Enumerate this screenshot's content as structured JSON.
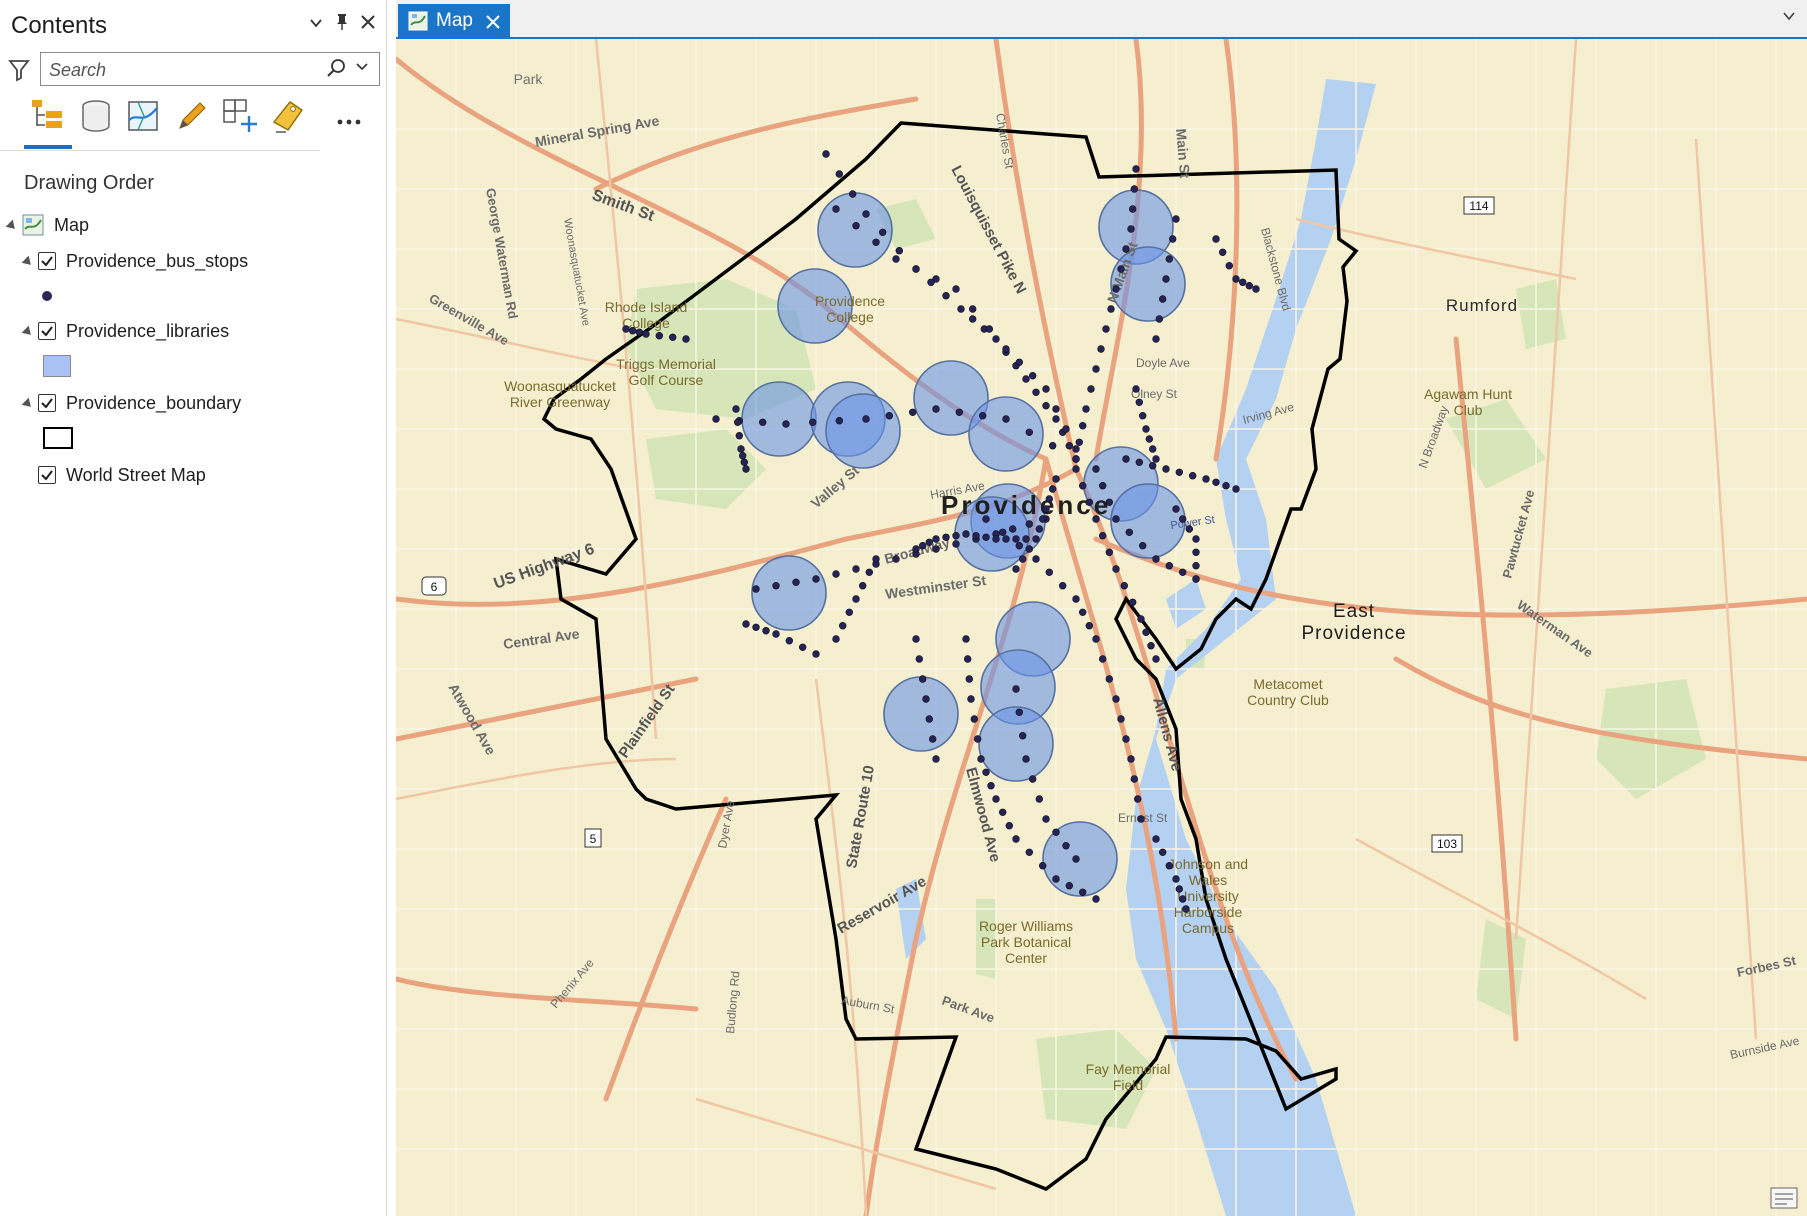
{
  "contents_pane": {
    "title": "Contents",
    "search_placeholder": "Search",
    "section_title": "Drawing Order",
    "toolbar_icons": [
      "list-by-drawing-order-icon",
      "list-by-source-icon",
      "list-by-selection-icon",
      "list-by-editing-icon",
      "list-by-snapping-icon",
      "list-by-labeling-icon",
      "more-options-icon"
    ],
    "layers": {
      "map": {
        "label": "Map"
      },
      "bus_stops": {
        "label": "Providence_bus_stops",
        "checked": true
      },
      "libraries": {
        "label": "Providence_libraries",
        "checked": true,
        "symbol_color": "#a8c2f5"
      },
      "boundary": {
        "label": "Providence_boundary",
        "checked": true
      },
      "basemap": {
        "label": "World Street Map",
        "checked": true
      }
    }
  },
  "map_view": {
    "tab_label": "Map",
    "accent_color": "#1a74c8",
    "place_labels": {
      "providence": "Providence",
      "east_providence_1": "East",
      "east_providence_2": "Providence",
      "rumford": "Rumford",
      "park": "Park",
      "ri_college_1": "Rhode Island",
      "ri_college_2": "College",
      "prov_college_1": "Providence",
      "prov_college_2": "College",
      "triggs_1": "Triggs Memorial",
      "triggs_2": "Golf Course",
      "woonasquatucket_1": "Woonasquatucket",
      "woonasquatucket_2": "River Greenway",
      "agawam_1": "Agawam Hunt",
      "agawam_2": "Club",
      "metacomet_1": "Metacomet",
      "metacomet_2": "Country Club",
      "jwu_1": "Johnson and",
      "jwu_2": "Wales",
      "jwu_3": "University",
      "jwu_4": "Harborside",
      "jwu_5": "Campus",
      "rw_park_1": "Roger Williams",
      "rw_park_2": "Park Botanical",
      "rw_park_3": "Center",
      "fay_1": "Fay Memorial",
      "fay_2": "Field"
    },
    "road_labels": {
      "mineral_spring": "Mineral Spring Ave",
      "smith": "Smith St",
      "us6": "US Highway 6",
      "broadway": "Broadway",
      "westminster": "Westminster St",
      "central": "Central Ave",
      "atwood": "Atwood Ave",
      "plainfield": "Plainfield St",
      "reservoir": "Reservoir Ave",
      "elmwood": "Elmwood Ave",
      "state_route_10": "State Route 10",
      "allens": "Allens Ave",
      "louisquisset": "Louisquisset Pike N",
      "n_main": "N Main St",
      "main": "Main St",
      "charles": "Charles St",
      "doyle": "Doyle Ave",
      "olney": "Olney St",
      "irving": "Irving Ave",
      "harris": "Harris Ave",
      "valley": "Valley St",
      "george_waterman": "George Waterman Rd",
      "greenville": "Greenville Ave",
      "woonasquatucket_ave": "Woonasquatucket Ave",
      "dyer": "Dyer Ave",
      "budlong": "Budlong Rd",
      "phenix": "Phenix Ave",
      "auburn": "Auburn St",
      "park_ave": "Park Ave",
      "ernest": "Ernest St",
      "pawtucket": "Pawtucket Ave",
      "waterman": "Waterman Ave",
      "n_broadway": "N Broadway",
      "forbes": "Forbes St",
      "burnside": "Burnside Ave",
      "power": "Power St",
      "blackstone": "Blackstone Blvd"
    },
    "shields": {
      "us6": "6",
      "r5": "5",
      "r114": "114",
      "r103": "103"
    }
  }
}
